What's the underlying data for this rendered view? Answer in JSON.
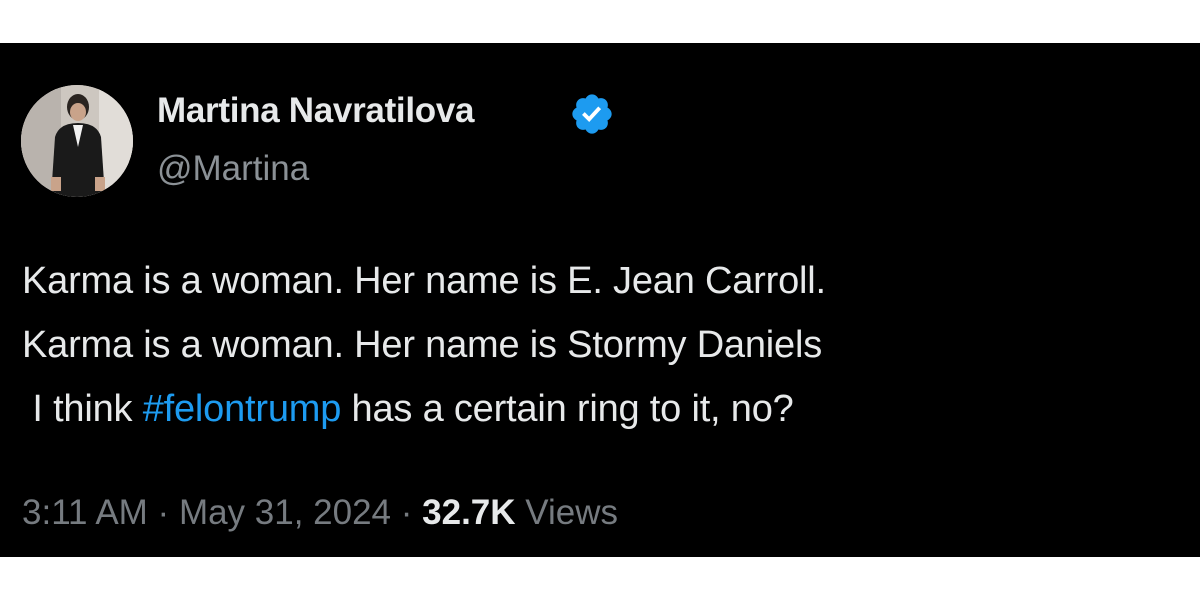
{
  "author": {
    "name": "Martina Navratilova",
    "handle": "@Martina",
    "verified_color": "#1d9bf0",
    "avatar_icon": "profile-photo"
  },
  "tweet": {
    "line1": "Karma is a woman. Her name is E. Jean Carroll.",
    "line2": "Karma is a woman. Her name is Stormy Daniels",
    "line3_before": " I think ",
    "hashtag": "#felontrump",
    "line3_after": " has a certain ring to it, no?"
  },
  "meta": {
    "time": "3:11 AM",
    "separator": " · ",
    "date": "May 31, 2024",
    "views_count": "32.7K",
    "views_label": " Views"
  },
  "colors": {
    "background": "#000000",
    "text": "#e7e9ea",
    "secondary": "#767b80",
    "link": "#1d9bf0"
  }
}
